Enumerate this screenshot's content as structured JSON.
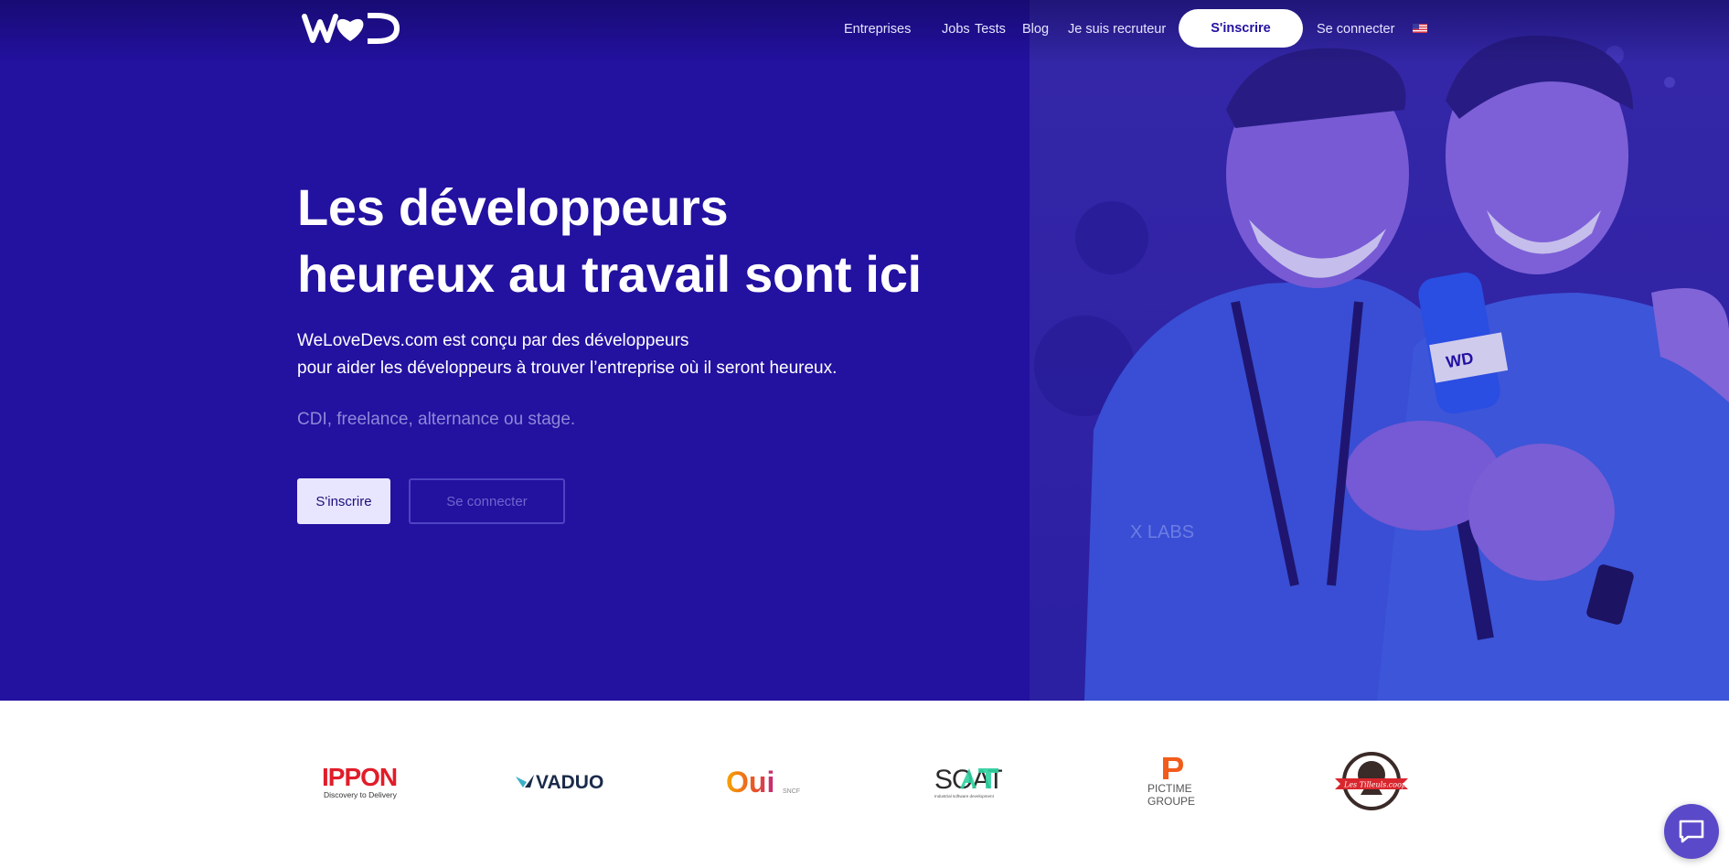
{
  "brand": {
    "logo_text": "WD"
  },
  "nav": {
    "items": [
      "Entreprises",
      "Jobs",
      "Tests",
      "Blog",
      "Je suis recruteur"
    ],
    "signup_label": "S'inscrire",
    "login_label": "Se connecter",
    "language": "en-us-flag"
  },
  "hero": {
    "title_line1": "Les développeurs",
    "title_line2": "heureux au travail sont ici",
    "subtitle_line1": "WeLoveDevs.com est conçu par des développeurs",
    "subtitle_line2": "pour aider les développeurs à trouver l’entreprise où il seront heureux.",
    "contract_types": "CDI, freelance, alternance ou stage.",
    "primary_cta": "S'inscrire",
    "secondary_cta": "Se connecter",
    "photo_mic_label": "WD",
    "photo_shirt_text": "X LABS"
  },
  "partners": [
    {
      "name": "IPPON",
      "tagline": "Discovery to Delivery"
    },
    {
      "name": "VADUO"
    },
    {
      "name": "Oui",
      "suffix": "SNCF"
    },
    {
      "name": "SOAT",
      "tagline": "Industrial software development"
    },
    {
      "name": "PICTIME",
      "tagline": "GROUPE"
    },
    {
      "name": "Les Tilleuls.coop"
    }
  ],
  "colors": {
    "hero_bg": "#2311a0",
    "accent": "#2311a0",
    "button_light": "#e8e6ff",
    "chat": "#5a49c8"
  },
  "chat": {
    "icon": "chat-icon"
  }
}
